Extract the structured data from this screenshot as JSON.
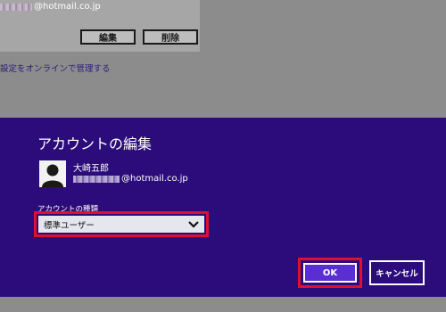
{
  "background": {
    "email_suffix": "@hotmail.co.jp",
    "edit_label": "編集",
    "delete_label": "削除",
    "link_text": "設定をオンラインで管理する"
  },
  "dialog": {
    "title": "アカウントの編集",
    "account_name": "大崎五郎",
    "account_email_suffix": "@hotmail.co.jp",
    "type_label": "アカウントの種類",
    "type_value": "標準ユーザー",
    "ok_label": "OK",
    "cancel_label": "キャンセル"
  },
  "colors": {
    "dialog_bg": "#2c0c7a",
    "highlight": "#e0102c",
    "ok_bg": "#5a2fd1"
  }
}
